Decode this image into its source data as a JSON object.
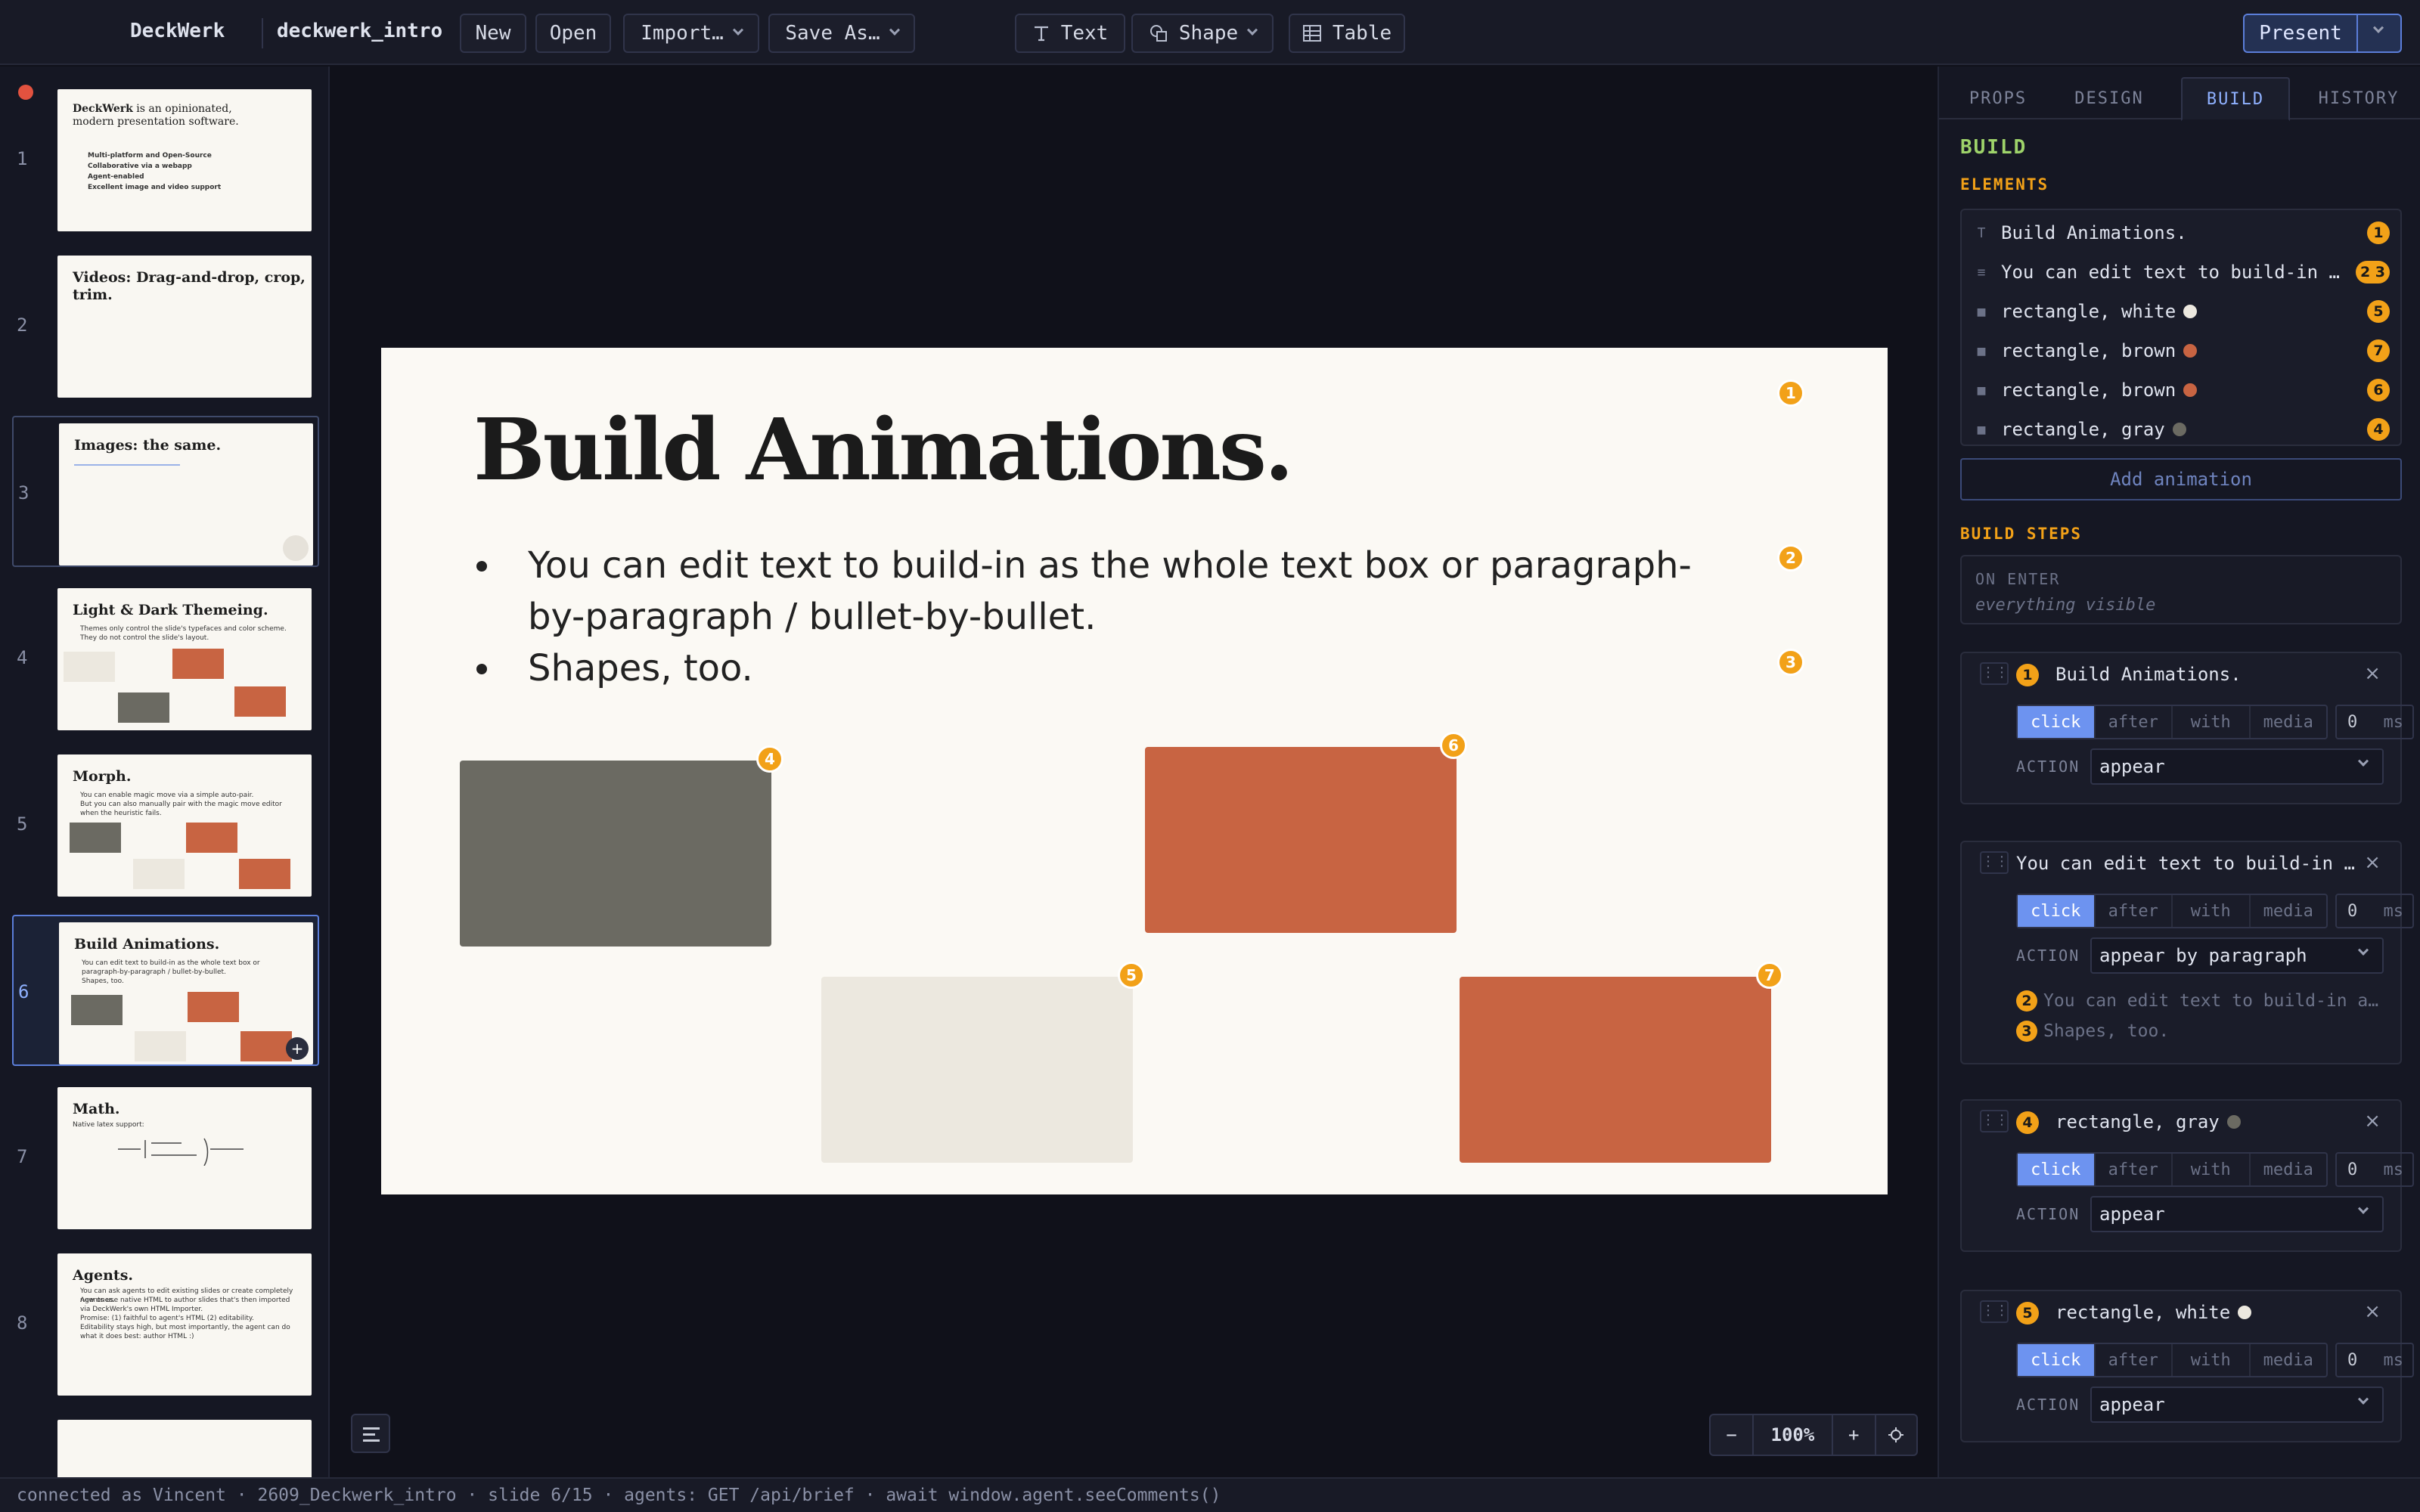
{
  "app": {
    "brand": "DeckWerk",
    "doc_name": "deckwerk_intro"
  },
  "toolbar": {
    "new": "New",
    "open": "Open",
    "import": "Import…",
    "save_as": "Save As…",
    "text": "Text",
    "shape": "Shape",
    "table": "Table",
    "present": "Present"
  },
  "colors": {
    "accent": "#6d93f0",
    "badge": "#f2a118",
    "brown": "#c86442",
    "gray": "#6b6a62",
    "white_shape": "#ece8df",
    "build_green": "#9ed36a"
  },
  "thumbnails": [
    {
      "num": "1",
      "title": "DeckWerk",
      "title_suffix": " is an opinionated, modern presentation software.",
      "lines": [
        "Multi-platform and Open-Source",
        "Collaborative via a webapp",
        "Agent-enabled",
        "Excellent image and video support"
      ]
    },
    {
      "num": "2",
      "title": "Videos: Drag-and-drop, crop, trim."
    },
    {
      "num": "3",
      "title": "Images: the same."
    },
    {
      "num": "4",
      "title": "Light & Dark Themeing.",
      "lines": [
        "Themes only control the slide's typefaces and color scheme.",
        "They do not control the slide's layout."
      ]
    },
    {
      "num": "5",
      "title": "Morph.",
      "lines": [
        "You can enable magic move via a simple auto-pair.",
        "But you can also manually pair with the magic move editor when the heuristic fails."
      ]
    },
    {
      "num": "6",
      "title": "Build Animations.",
      "lines": [
        "You can edit text to build-in as the whole text box or paragraph-by-paragraph / bullet-by-bullet.",
        "Shapes, too."
      ],
      "plus": "+"
    },
    {
      "num": "7",
      "title": "Math.",
      "lines": [
        "Native latex support:"
      ]
    },
    {
      "num": "8",
      "title": "Agents.",
      "lines": [
        "You can ask agents to edit existing slides or create completely new ones.",
        "Agents use native HTML to author slides that's then imported via DeckWerk's own HTML Importer.",
        "Promise: (1) faithful to agent's HTML (2) editability.",
        "Editability stays high, but most importantly, the agent can do what it does best: author HTML :)"
      ]
    }
  ],
  "slide": {
    "title": "Build Animations.",
    "bullets": [
      "You can edit text to build-in as the whole text box or paragraph-by-paragraph / bullet-by-bullet.",
      "Shapes, too."
    ],
    "badges": [
      "1",
      "2",
      "3",
      "4",
      "5",
      "6",
      "7"
    ]
  },
  "zoom": {
    "minus": "−",
    "value": "100%",
    "plus": "+"
  },
  "panel": {
    "tabs": [
      "PROPS",
      "DESIGN",
      "BUILD",
      "HISTORY"
    ],
    "active_tab": "BUILD",
    "heading": "BUILD",
    "elements_heading": "ELEMENTS",
    "elements": [
      {
        "kind": "T",
        "name": "Build Animations.",
        "order": "1"
      },
      {
        "kind": "≡",
        "name": "You can edit text to build-in as the whole text box",
        "order": "2 3"
      },
      {
        "kind": "■",
        "name": "rectangle, white",
        "order": "5",
        "color": "#ece8df"
      },
      {
        "kind": "■",
        "name": "rectangle, brown",
        "order": "7",
        "color": "#c86442"
      },
      {
        "kind": "■",
        "name": "rectangle, brown",
        "order": "6",
        "color": "#c86442"
      },
      {
        "kind": "■",
        "name": "rectangle, gray",
        "order": "4",
        "color": "#6b6a62"
      }
    ],
    "add_animation": "Add animation",
    "build_steps_heading": "BUILD STEPS",
    "on_enter_label": "ON ENTER",
    "on_enter_value": "everything visible",
    "triggers": [
      "click",
      "after",
      "with",
      "media"
    ],
    "action_label": "ACTION",
    "ms_unit": "ms",
    "steps": [
      {
        "num": "1",
        "title": "Build Animations.",
        "ms": "0",
        "action": "appear"
      },
      {
        "num": "",
        "title": "You can edit text to build-in as the whole text box",
        "ms": "0",
        "action": "appear by paragraph",
        "subs": [
          {
            "num": "2",
            "text": "You can edit text to build-in as the whole text box"
          },
          {
            "num": "3",
            "text": "Shapes, too."
          }
        ]
      },
      {
        "num": "4",
        "title": "rectangle, gray",
        "ms": "0",
        "action": "appear",
        "color": "#6b6a62"
      },
      {
        "num": "5",
        "title": "rectangle, white",
        "ms": "0",
        "action": "appear",
        "color": "#ece8df"
      }
    ],
    "close": "×"
  },
  "status": "connected as Vincent · 2609_Deckwerk_intro · slide 6/15 · agents: GET /api/brief · await window.agent.seeComments()"
}
